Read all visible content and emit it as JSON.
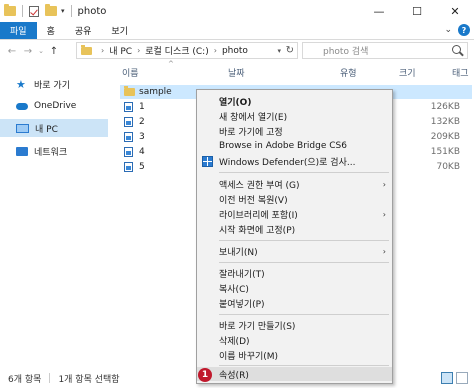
{
  "window": {
    "title": "photo",
    "minimize": "—",
    "maximize": "☐",
    "close": "✕"
  },
  "ribbon": {
    "tabs": [
      "파일",
      "홈",
      "공유",
      "보기"
    ]
  },
  "address": {
    "segments": [
      "내 PC",
      "로컬 디스크 (C:)",
      "photo"
    ],
    "search_placeholder": "photo 검색"
  },
  "navpane": {
    "items": [
      "바로 가기",
      "OneDrive",
      "내 PC",
      "네트워크"
    ]
  },
  "columns": {
    "name": "이름",
    "date": "날짜",
    "type": "유형",
    "size": "크기",
    "tags": "태그"
  },
  "files": [
    {
      "name": "sample",
      "size": ""
    },
    {
      "name": "1",
      "size": "126KB"
    },
    {
      "name": "2",
      "size": "132KB"
    },
    {
      "name": "3",
      "size": "209KB"
    },
    {
      "name": "4",
      "size": "151KB"
    },
    {
      "name": "5",
      "size": "70KB"
    }
  ],
  "context_menu": {
    "open": "열기(O)",
    "open_new_window": "새 창에서 열기(E)",
    "pin_quick": "바로 가기에 고정",
    "browse_bridge": "Browse in Adobe Bridge CS6",
    "defender": "Windows Defender(으)로 검사...",
    "give_access": "액세스 권한 부여 (G)",
    "restore_prev": "이전 버전 복원(V)",
    "include_library": "라이브러리에 포함(I)",
    "pin_start": "시작 화면에 고정(P)",
    "send_to": "보내기(N)",
    "cut": "잘라내기(T)",
    "copy": "복사(C)",
    "paste": "붙여넣기(P)",
    "create_shortcut": "바로 가기 만들기(S)",
    "delete": "삭제(D)",
    "rename": "이름 바꾸기(M)",
    "properties": "속성(R)",
    "badge": "1"
  },
  "status": {
    "count": "6개 항목",
    "selected": "1개 항목 선택함"
  }
}
